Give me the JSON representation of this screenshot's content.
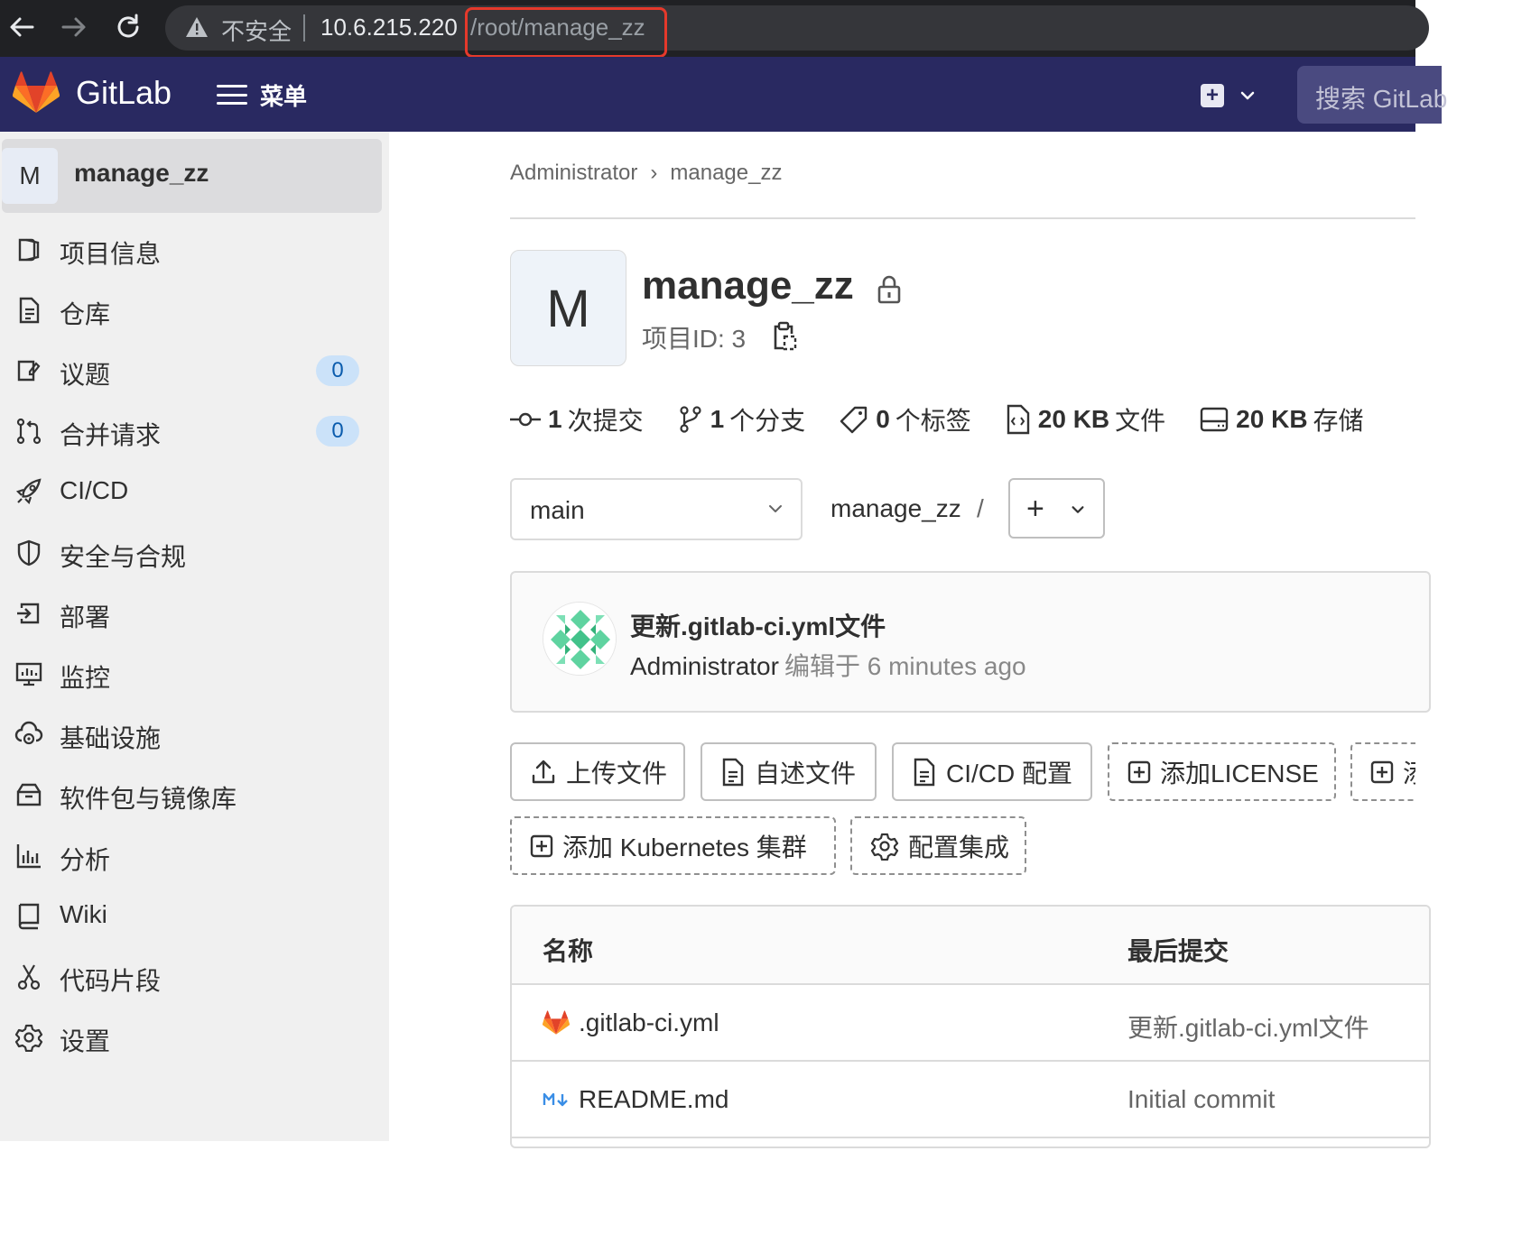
{
  "browser": {
    "security_text": "不安全",
    "host": "10.6.215.220",
    "path": "/root/manage_zz"
  },
  "topnav": {
    "brand": "GitLab",
    "menu_label": "菜单",
    "search_placeholder": "搜索 GitLab",
    "header_color": "#292961"
  },
  "sidebar": {
    "project_initial": "M",
    "project_name": "manage_zz",
    "items": [
      {
        "label": "项目信息",
        "icon": "project-info-icon"
      },
      {
        "label": "仓库",
        "icon": "repository-icon"
      },
      {
        "label": "议题",
        "icon": "issues-icon",
        "badge": "0"
      },
      {
        "label": "合并请求",
        "icon": "merge-request-icon",
        "badge": "0"
      },
      {
        "label": "CI/CD",
        "icon": "rocket-icon"
      },
      {
        "label": "安全与合规",
        "icon": "shield-icon"
      },
      {
        "label": "部署",
        "icon": "deployments-icon"
      },
      {
        "label": "监控",
        "icon": "monitor-icon"
      },
      {
        "label": "基础设施",
        "icon": "cloud-gear-icon"
      },
      {
        "label": "软件包与镜像库",
        "icon": "package-icon"
      },
      {
        "label": "分析",
        "icon": "chart-icon"
      },
      {
        "label": "Wiki",
        "icon": "book-icon"
      },
      {
        "label": "代码片段",
        "icon": "scissors-icon"
      },
      {
        "label": "设置",
        "icon": "gear-icon"
      }
    ]
  },
  "breadcrumb": {
    "items": [
      "Administrator",
      "manage_zz"
    ],
    "separator": "›"
  },
  "project": {
    "initial": "M",
    "name": "manage_zz",
    "id_text": "项目ID: 3"
  },
  "stats": {
    "commits_count": "1",
    "commits_label": "次提交",
    "branches_count": "1",
    "branches_label": "个分支",
    "tags_count": "0",
    "tags_label": "个标签",
    "files_size": "20 KB",
    "files_label": "文件",
    "storage_size": "20 KB",
    "storage_label": "存储"
  },
  "repo_nav": {
    "branch": "main",
    "path": "manage_zz",
    "path_sep": "/",
    "add_symbol": "+"
  },
  "last_commit": {
    "title": "更新.gitlab-ci.yml文件",
    "author": "Administrator",
    "meta": "编辑于 6 minutes ago"
  },
  "actions": {
    "upload": "上传文件",
    "readme": "自述文件",
    "cicd": "CI/CD 配置",
    "license": "添加LICENSE",
    "add_more": "添加",
    "kubernetes": "添加 Kubernetes 集群",
    "integrations": "配置集成"
  },
  "files": {
    "header_name": "名称",
    "header_last_commit": "最后提交",
    "rows": [
      {
        "name": ".gitlab-ci.yml",
        "last_commit": "更新.gitlab-ci.yml文件",
        "icon": "gitlab-fox-icon"
      },
      {
        "name": "README.md",
        "last_commit": "Initial commit",
        "icon": "markdown-icon"
      }
    ]
  }
}
